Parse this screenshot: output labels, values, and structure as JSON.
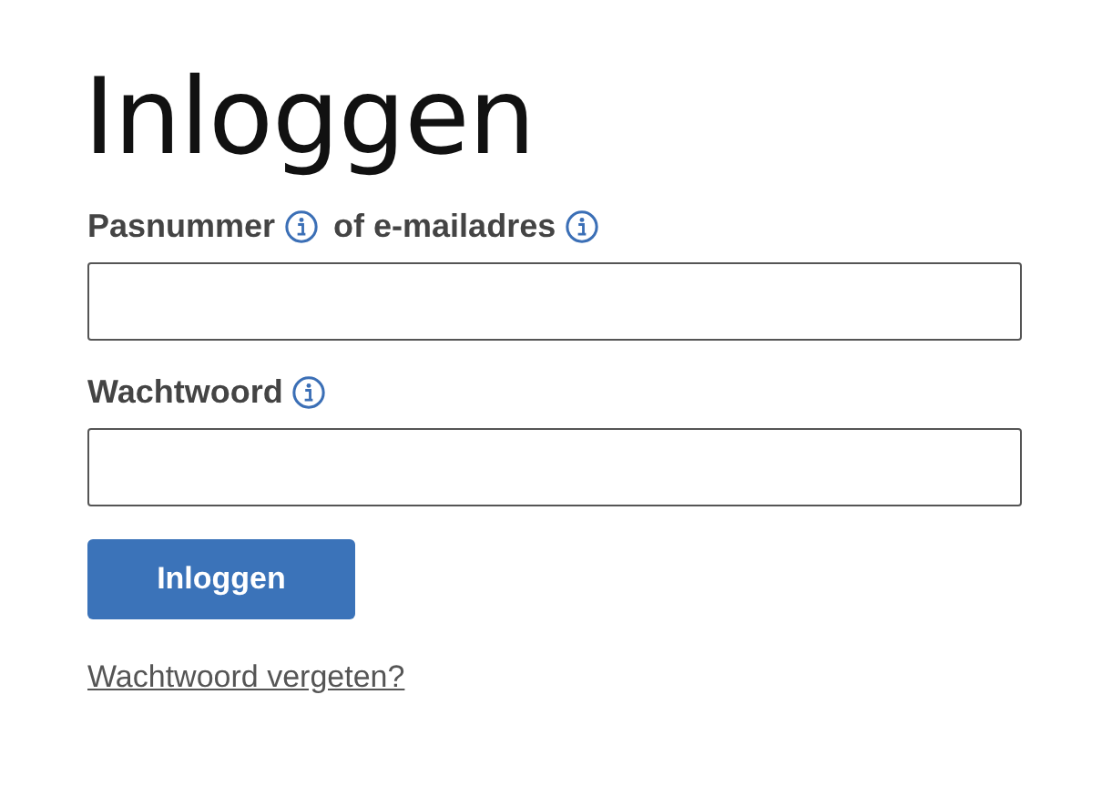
{
  "title": "Inloggen",
  "fields": [
    {
      "label_parts": [
        {
          "text": "Pasnummer",
          "info": true
        },
        {
          "text": "of e-mailadres",
          "info": true
        }
      ]
    },
    {
      "label_parts": [
        {
          "text": "Wachtwoord",
          "info": true
        }
      ]
    }
  ],
  "submit_button": "Inloggen",
  "forgot_link": "Wachtwoord vergeten?"
}
